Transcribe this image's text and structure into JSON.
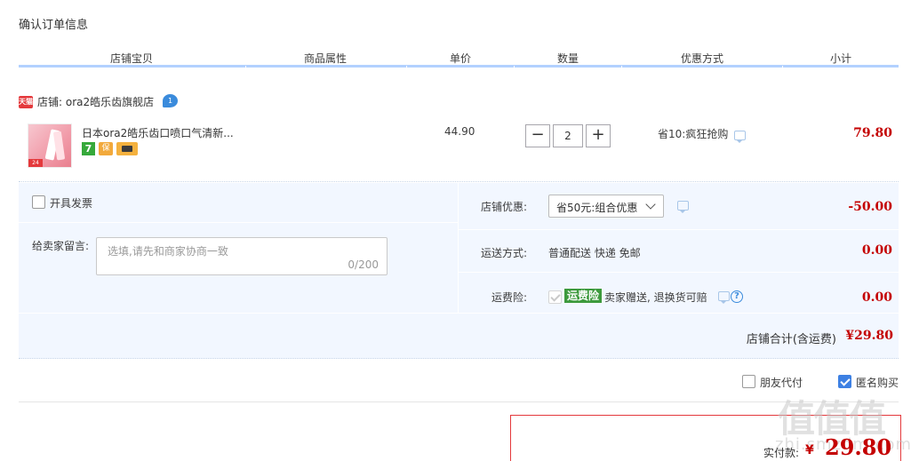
{
  "page_title": "确认订单信息",
  "columns": [
    "店铺宝贝",
    "商品属性",
    "单价",
    "数量",
    "优惠方式",
    "小计"
  ],
  "shop": {
    "badge": "天猫",
    "name": "店铺: ora2皓乐齿旗舰店",
    "chat_count": "1"
  },
  "item": {
    "name": "日本ora2皓乐齿口喷口气清新...",
    "thumb_tag": "24",
    "price": "44.90",
    "quantity": "2",
    "promo": "省10:疯狂抢购",
    "subtotal": "79.80",
    "service_icons": [
      "seven-day-return-icon",
      "guarantee-shield-icon",
      "credit-card-icon"
    ],
    "service_icon_seven": "7",
    "service_icon_shield": "保"
  },
  "options": {
    "invoice_label": "开具发票",
    "message_label": "给卖家留言:",
    "message_placeholder": "选填,请先和商家协商一致",
    "message_count": "0/200",
    "shop_discount_label": "店铺优惠:",
    "shop_discount_selected": "省50元:组合优惠",
    "shop_discount_amount": "-50.00",
    "shipping_label": "运送方式:",
    "shipping_value": "普通配送 快递 免邮",
    "shipping_amount": "0.00",
    "insurance_label": "运费险:",
    "insurance_badge": "运费险",
    "insurance_text": "卖家赠送, 退换货可赔",
    "insurance_amount": "0.00",
    "help_glyph": "?"
  },
  "shop_total": {
    "label": "店铺合计(含运费)",
    "value": "¥29.80"
  },
  "checkout": {
    "friend_pay_label": "朋友代付",
    "anonymous_label": "匿名购买",
    "anonymous_checked": true,
    "pay_label": "实付款:",
    "pay_currency": "¥",
    "pay_value": "29.80"
  },
  "watermark": {
    "main": "值值值",
    "sub": "zhi.smzdm.com"
  },
  "colors": {
    "accent_red": "#c40000",
    "header_line": "#b2d1ff",
    "options_bg": "#f2f7ff",
    "check_blue": "#3d80e3",
    "insurance_green": "#3d9a3d"
  }
}
